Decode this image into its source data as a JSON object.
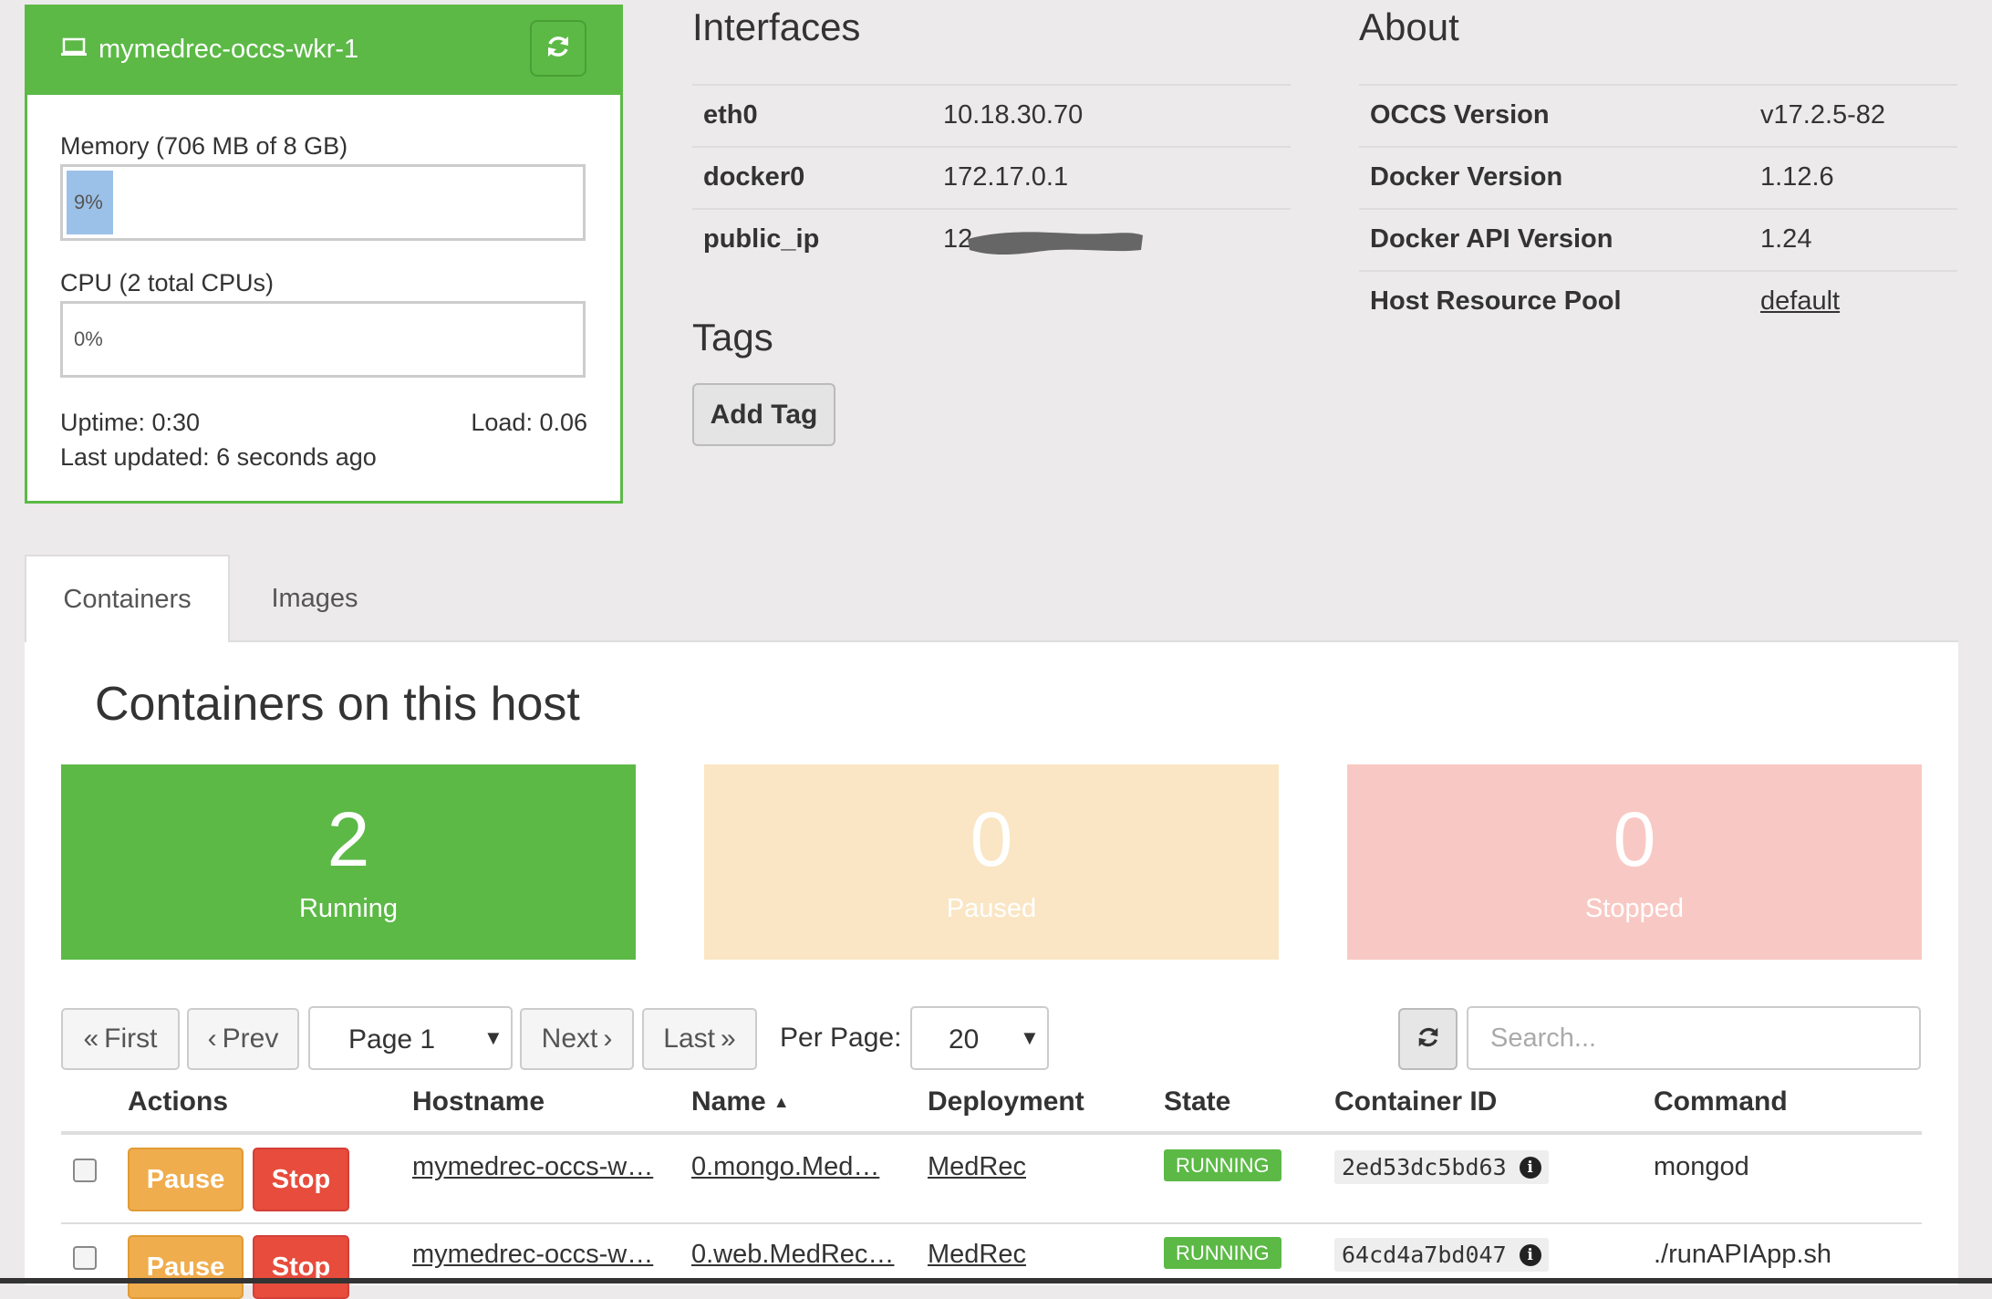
{
  "host": {
    "name": "mymedrec-occs-wkr-1",
    "memory_label": "Memory (706 MB of 8 GB)",
    "memory_percent": 9,
    "memory_text": "9%",
    "cpu_label": "CPU (2 total CPUs)",
    "cpu_percent": 0,
    "cpu_text": "0%",
    "uptime": "Uptime: 0:30",
    "load": "Load: 0.06",
    "last_updated": "Last updated: 6 seconds ago"
  },
  "interfaces": {
    "title": "Interfaces",
    "rows": [
      {
        "name": "eth0",
        "ip": "10.18.30.70"
      },
      {
        "name": "docker0",
        "ip": "172.17.0.1"
      },
      {
        "name": "public_ip",
        "ip": "12"
      }
    ]
  },
  "tags": {
    "title": "Tags",
    "add_label": "Add Tag"
  },
  "about": {
    "title": "About",
    "rows": [
      {
        "key": "OCCS Version",
        "value": "v17.2.5-82"
      },
      {
        "key": "Docker Version",
        "value": "1.12.6"
      },
      {
        "key": "Docker API Version",
        "value": "1.24"
      },
      {
        "key": "Host Resource Pool",
        "value": "default"
      }
    ]
  },
  "tabs": [
    {
      "label": "Containers"
    },
    {
      "label": "Images"
    }
  ],
  "panel_title": "Containers on this host",
  "counts": [
    {
      "number": "2",
      "label": "Running"
    },
    {
      "number": "0",
      "label": "Paused"
    },
    {
      "number": "0",
      "label": "Stopped"
    }
  ],
  "colors": {
    "green": "#5cb946",
    "paused_bg": "#fae6c4",
    "stopped_bg": "#f8c9c4",
    "pause_btn": "#f0ad4e",
    "stop_btn": "#e74c3c"
  },
  "pagination": {
    "first": "First",
    "prev": "Prev",
    "page": "Page 1",
    "next": "Next",
    "last": "Last",
    "per_page_label": "Per Page:",
    "per_page": "20",
    "search_placeholder": "Search..."
  },
  "table": {
    "headers": [
      "Actions",
      "Hostname",
      "Name",
      "Deployment",
      "State",
      "Container ID",
      "Command"
    ],
    "pause_label": "Pause",
    "stop_label": "Stop",
    "rows": [
      {
        "hostname": "mymedrec-occs-w…",
        "name": "0.mongo.Med…",
        "deployment": "MedRec",
        "state": "RUNNING",
        "container_id": "2ed53dc5bd63",
        "command": "mongod"
      },
      {
        "hostname": "mymedrec-occs-w…",
        "name": "0.web.MedRec…",
        "deployment": "MedRec",
        "state": "RUNNING",
        "container_id": "64cd4a7bd047",
        "command": "./runAPIApp.sh"
      }
    ]
  }
}
